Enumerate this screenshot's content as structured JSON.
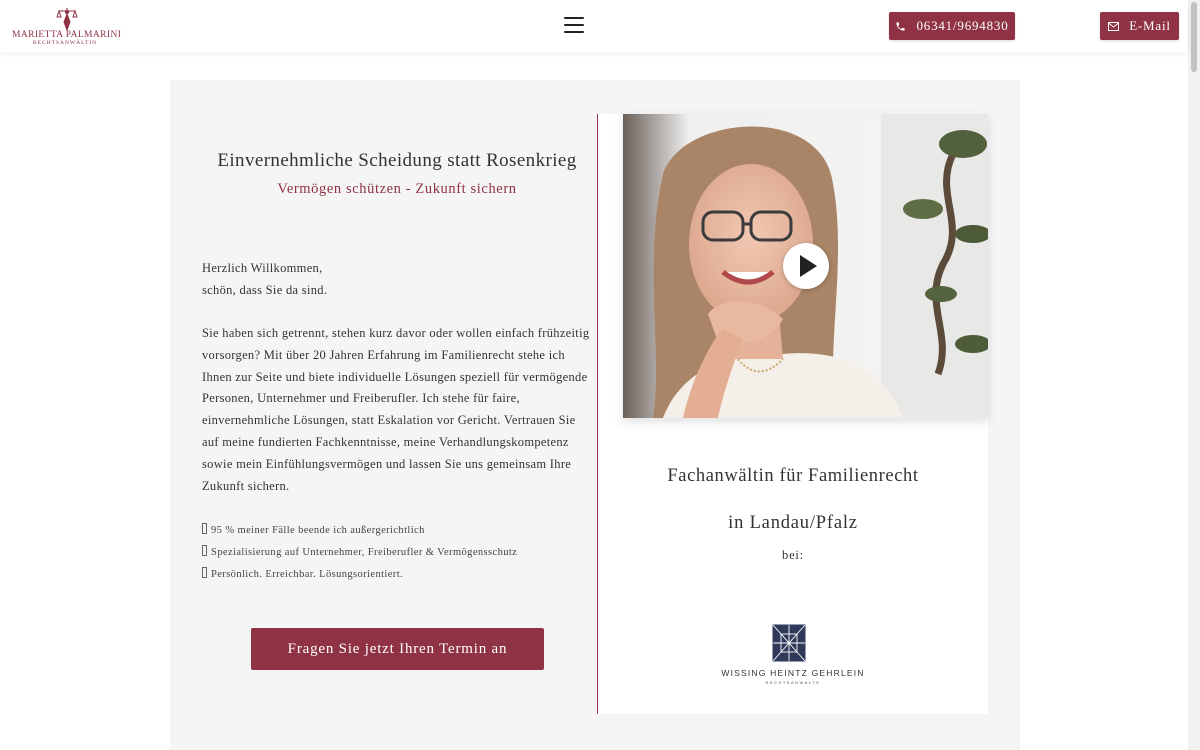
{
  "header": {
    "logo_name": "MARIETTA PALMARINI",
    "logo_subtitle": "RECHTSANWÄLTIN",
    "phone_label": "06341/9694830",
    "email_label": "E-Mail"
  },
  "hero": {
    "headline": "Einvernehmliche Scheidung statt Rosenkrieg",
    "subheadline": "Vermögen schützen - Zukunft sichern",
    "welcome_line1": "Herzlich Willkommen,",
    "welcome_line2": "schön, dass Sie da sind.",
    "body": "Sie haben sich getrennt, stehen kurz davor oder wollen einfach  frühzeitig vorsorgen? Mit über 20 Jahren Erfahrung im Familienrecht stehe ich Ihnen zur Seite und biete individuelle Lösungen speziell für vermögende Personen, Unternehmer und Freiberufler. Ich stehe für faire, einvernehmliche Lösungen, statt Eskalation vor Gericht. Vertrauen Sie auf meine fundierten Fachkenntnisse, meine Verhandlungskompetenz sowie mein Einfühlungsvermögen und lassen Sie uns gemeinsam Ihre Zukunft sichern.",
    "bullets": [
      "95 % meiner Fälle beende ich außergerichtlich",
      "Spezialisierung auf Unternehmer, Freiberufler & Vermögensschutz",
      "Persönlich. Erreichbar. Lösungsorientiert."
    ],
    "cta_label": "Fragen Sie jetzt Ihren Termin an"
  },
  "profile": {
    "title": "Fachanwältin für Familienrecht",
    "location": "in Landau/Pfalz",
    "bei": "bei:",
    "firm_name": "WISSING HEINTZ GEHRLEIN",
    "firm_subtitle": "RECHTSANWÄLTE"
  },
  "colors": {
    "accent": "#8f3244",
    "panel_bg": "#f5f5f5",
    "text": "#333333"
  },
  "icons": [
    "phone-icon",
    "mail-icon",
    "menu-icon",
    "play-icon",
    "justitia-logo-icon",
    "firm-logo-icon"
  ]
}
